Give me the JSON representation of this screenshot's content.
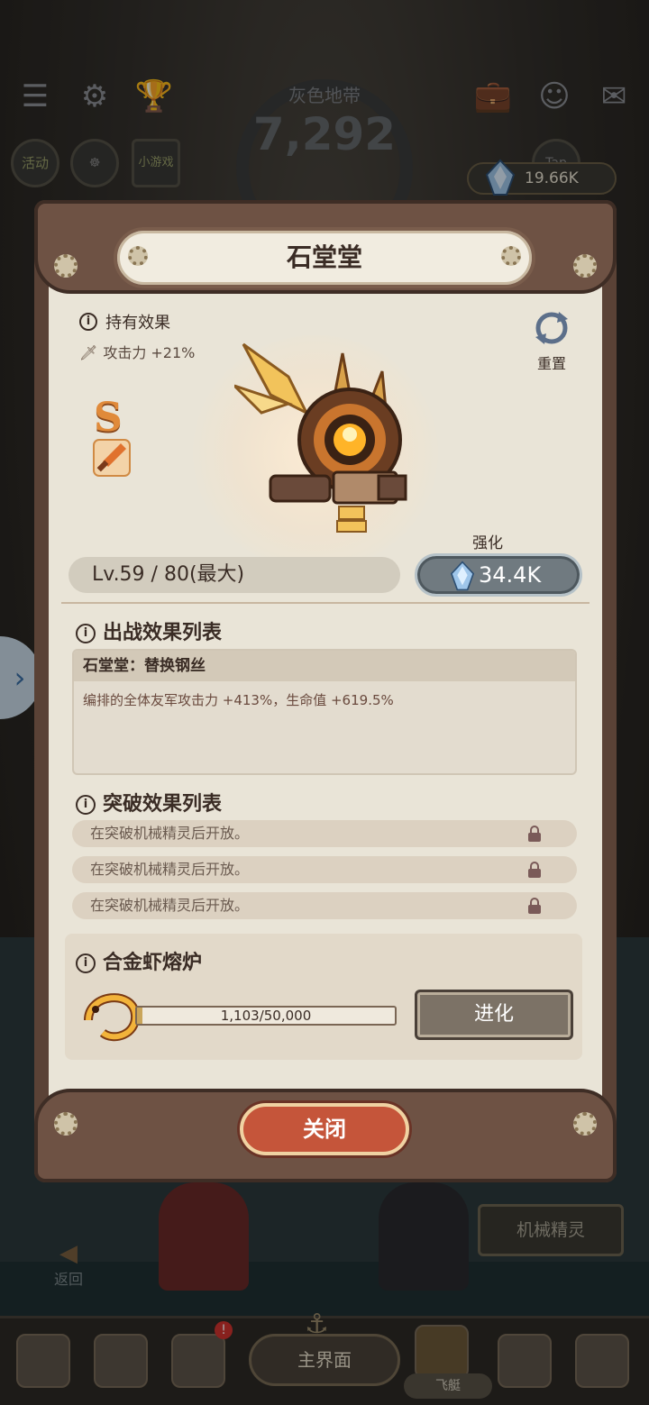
{
  "hud": {
    "zone_title": "灰色地带",
    "zone_score": "7,292",
    "currency_amount": "19.66K",
    "left_badges": [
      "活动",
      "",
      "小游戏"
    ],
    "right_badges": [
      "",
      "Tap",
      ""
    ]
  },
  "modal": {
    "title": "石堂堂",
    "hold_effect_title": "持有效果",
    "hold_effect_line": "攻击力 +21%",
    "reset_label": "重置",
    "rank": "S",
    "upgrade_label": "强化",
    "level_text": "Lv.59 / 80(最大)",
    "upgrade_cost": "34.4K",
    "battle_section_title": "出战效果列表",
    "battle_effect_name": "石堂堂：替换钢丝",
    "battle_effect_desc": "编排的全体友军攻击力 +413%，生命值 +619.5%",
    "breakthrough_section_title": "突破效果列表",
    "breakthrough_rows": [
      "在突破机械精灵后开放。",
      "在突破机械精灵后开放。",
      "在突破机械精灵后开放。"
    ],
    "furnace_title": "合金虾熔炉",
    "furnace_progress_text": "1,103/50,000",
    "furnace_progress_fraction": 0.02206,
    "evolve_label": "进化",
    "close_label": "关闭"
  },
  "scene": {
    "mech_spirit_label": "机械精灵",
    "back_label": "返回",
    "main_label": "主界面",
    "ship_label": "飞艇",
    "notification_badge": "!"
  },
  "colors": {
    "frame": "#5a4236",
    "panel": "#e9e4d7",
    "close_button": "#c5553a",
    "upgrade_button": "#707a80",
    "rank_color": "#e08a3a"
  }
}
